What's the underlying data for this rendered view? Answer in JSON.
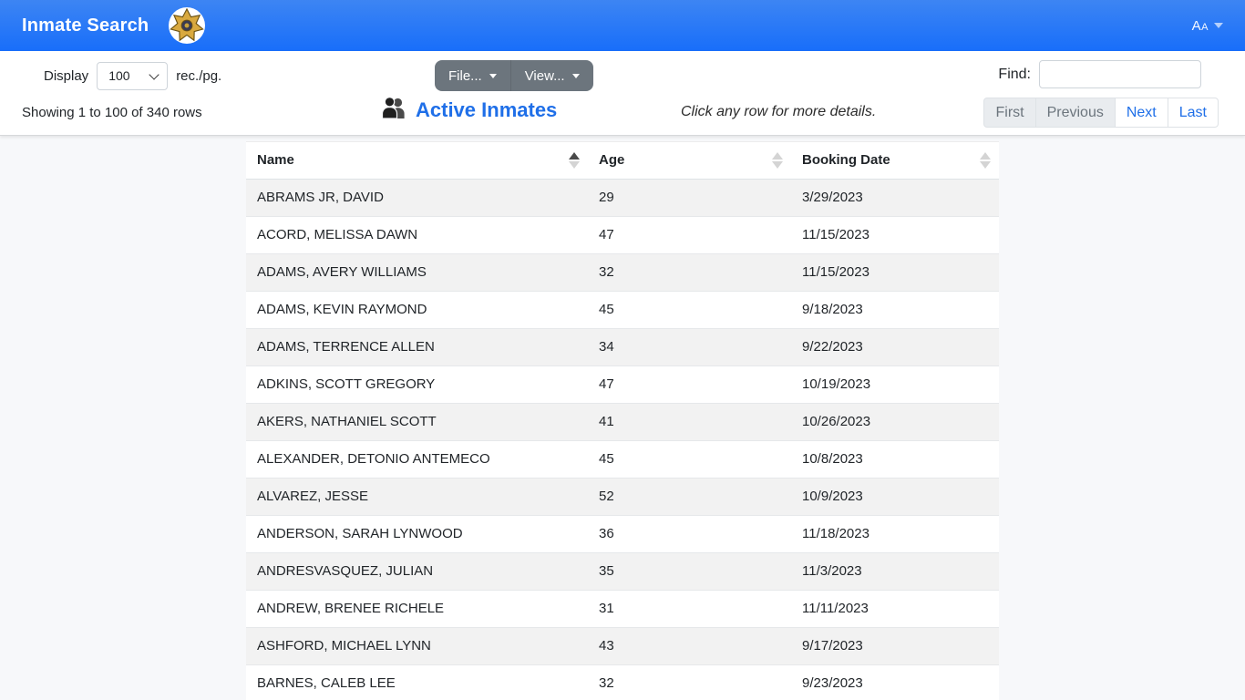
{
  "header": {
    "title": "Inmate Search",
    "font_size_label": "Aa",
    "logo_icon": "sheriff-badge-icon"
  },
  "toolbar": {
    "display_label": "Display",
    "page_size_value": "100",
    "page_size_suffix": "rec./pg.",
    "file_button": "File...",
    "view_button": "View...",
    "find_label": "Find:",
    "find_value": ""
  },
  "status": {
    "showing_text": "Showing 1 to 100 of 340 rows",
    "table_title": "Active Inmates",
    "hint": "Click any row for more details.",
    "title_icon": "people-icon"
  },
  "pagination": {
    "first": "First",
    "previous": "Previous",
    "next": "Next",
    "last": "Last"
  },
  "table": {
    "columns": [
      {
        "label": "Name",
        "sort": "asc"
      },
      {
        "label": "Age",
        "sort": "none"
      },
      {
        "label": "Booking Date",
        "sort": "none"
      }
    ],
    "rows": [
      {
        "name": "ABRAMS JR, DAVID",
        "age": "29",
        "booking_date": "3/29/2023"
      },
      {
        "name": "ACORD, MELISSA DAWN",
        "age": "47",
        "booking_date": "11/15/2023"
      },
      {
        "name": "ADAMS, AVERY WILLIAMS",
        "age": "32",
        "booking_date": "11/15/2023"
      },
      {
        "name": "ADAMS, KEVIN RAYMOND",
        "age": "45",
        "booking_date": "9/18/2023"
      },
      {
        "name": "ADAMS, TERRENCE ALLEN",
        "age": "34",
        "booking_date": "9/22/2023"
      },
      {
        "name": "ADKINS, SCOTT GREGORY",
        "age": "47",
        "booking_date": "10/19/2023"
      },
      {
        "name": "AKERS, NATHANIEL SCOTT",
        "age": "41",
        "booking_date": "10/26/2023"
      },
      {
        "name": "ALEXANDER, DETONIO ANTEMECO",
        "age": "45",
        "booking_date": "10/8/2023"
      },
      {
        "name": "ALVAREZ, JESSE",
        "age": "52",
        "booking_date": "10/9/2023"
      },
      {
        "name": "ANDERSON, SARAH LYNWOOD",
        "age": "36",
        "booking_date": "11/18/2023"
      },
      {
        "name": "ANDRESVASQUEZ, JULIAN",
        "age": "35",
        "booking_date": "11/3/2023"
      },
      {
        "name": "ANDREW, BRENEE RICHELE",
        "age": "31",
        "booking_date": "11/11/2023"
      },
      {
        "name": "ASHFORD, MICHAEL LYNN",
        "age": "43",
        "booking_date": "9/17/2023"
      },
      {
        "name": "BARNES, CALEB LEE",
        "age": "32",
        "booking_date": "9/23/2023"
      }
    ]
  },
  "colors": {
    "header_top": "#3d85f3",
    "header_bottom": "#186efa",
    "accent": "#1f6fe8",
    "btn_gray": "#6c757d",
    "stripe": "#f2f2f2",
    "page_bg": "#f7f8fa",
    "disabled_bg": "#e9ecef"
  }
}
